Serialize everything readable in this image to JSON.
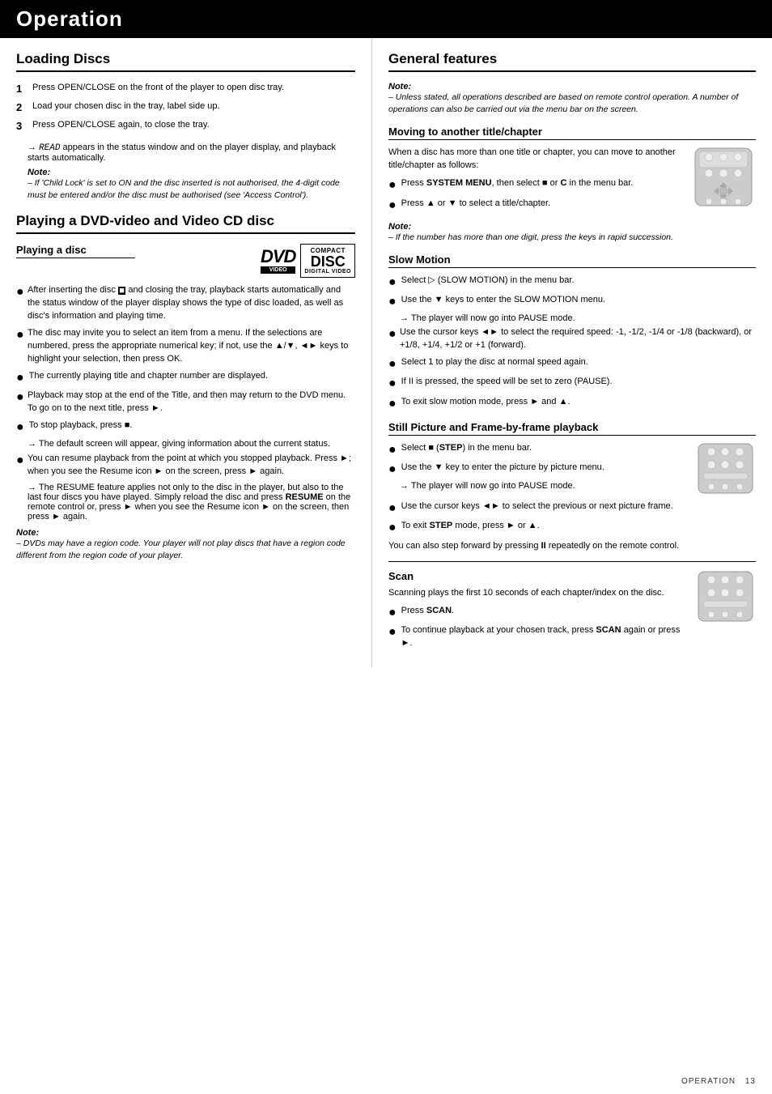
{
  "header": {
    "title": "Operation"
  },
  "left": {
    "loading_title": "Loading Discs",
    "loading_steps": [
      {
        "num": "1",
        "text": "Press OPEN/CLOSE on the front of the player to open disc tray."
      },
      {
        "num": "2",
        "text": "Load your chosen disc in the tray, label side up."
      },
      {
        "num": "3",
        "text": "Press OPEN/CLOSE again, to close the tray."
      }
    ],
    "loading_step3_arrow": "READ appears in the status window and on the player display, and playback starts automatically.",
    "loading_note_label": "Note:",
    "loading_note": "– If 'Child Lock' is set to ON and the disc inserted is not authorised, the 4-digit code must be entered and/or the disc must be authorised (see 'Access Control').",
    "playing_title": "Playing a DVD-video and Video CD disc",
    "playing_disc_sub": "Playing a disc",
    "playing_bullets": [
      "After inserting the disc and closing the tray, playback starts automatically and the status window of the player display shows the type of disc loaded, as well as disc's information and playing time.",
      "The disc may invite you to select an item from a menu. If the selections are numbered, press the appropriate numerical key; if not, use the ▲/▼, ◄► keys to highlight your selection, then press OK.",
      "The currently playing title and chapter number are displayed.",
      "Playback may stop at the end of the Title, and then may return to the DVD menu. To go on to the next title, press ►.",
      "To stop playback, press ■."
    ],
    "bullet5_arrow": "The default screen will appear, giving information about the current status.",
    "bullet6": "You can resume playback from the point at which you stopped playback. Press ►; when you see the Resume icon ► on the screen, press ► again.",
    "bullet6_arrow": "The RESUME feature applies not only to the disc in the player, but also to the last four discs you have played. Simply reload the disc and press RESUME on the remote control or, press ► when you see the Resume icon ► on the screen, then press ► again.",
    "playing_note_label": "Note:",
    "playing_note": "– DVDs may have a region code. Your player will not play discs that have a region code different from the region code of your player."
  },
  "right": {
    "general_title": "General features",
    "general_note_label": "Note:",
    "general_note": "– Unless stated, all operations described are based on remote control operation. A number of operations can also be carried out via the menu bar on the screen.",
    "moving_title": "Moving to another title/chapter",
    "moving_intro": "When a disc has more than one title or chapter, you can move to another title/chapter as follows:",
    "moving_bullets": [
      "Press SYSTEM MENU, then select ■ or C in the menu bar.",
      "Press ▲ or ▼ to select a title/chapter."
    ],
    "moving_note_label": "Note:",
    "moving_note": "– If the number has more than one digit, press the keys in rapid succession.",
    "slow_motion_title": "Slow Motion",
    "slow_motion_bullets": [
      "Select ▷ (SLOW MOTION) in the menu bar.",
      "Use the ▼ keys to enter the SLOW MOTION menu."
    ],
    "slow_bullet2_arrow": "The player will now go into PAUSE mode.",
    "slow_motion_bullets2": [
      "Use the cursor keys ◄► to select the required speed: -1, -1/2, -1/4 or -1/8 (backward), or +1/8, +1/4, +1/2 or +1 (forward).",
      "Select 1 to play the disc at normal speed again.",
      "If II is pressed, the speed will be set to zero (PAUSE).",
      "To exit slow motion mode, press ► and ▲."
    ],
    "still_title": "Still Picture and Frame-by-frame playback",
    "still_bullets1": [
      "Select ■ (STEP) in the menu bar.",
      "Use the ▼ key to enter the picture by picture menu."
    ],
    "still_bullet2_arrow": "The player will now go into PAUSE mode.",
    "still_bullets2": [
      "Use the cursor keys ◄► to select the previous or next picture frame.",
      "To exit STEP mode, press ► or ▲."
    ],
    "still_extra": "You can also step forward by pressing II repeatedly on the remote control.",
    "scan_title": "Scan",
    "scan_intro": "Scanning plays the first 10 seconds of each chapter/index on the disc.",
    "scan_bullets": [
      "Press SCAN.",
      "To continue playback at your chosen track, press SCAN again or press ►."
    ]
  },
  "footer": {
    "text": "OPERATION",
    "page": "13"
  }
}
